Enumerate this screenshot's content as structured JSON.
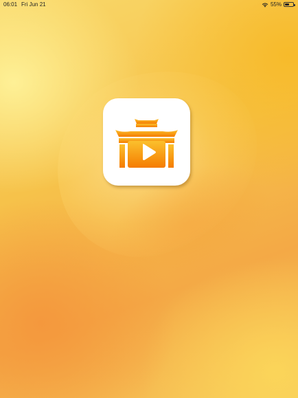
{
  "status_bar": {
    "time": "06:01",
    "date": "Fri Jun 21",
    "battery_percent_label": "55%",
    "battery_level": 0.55,
    "icons": [
      "wifi-icon",
      "battery-icon"
    ]
  },
  "app": {
    "icon": "temple-play-icon",
    "colors": {
      "background": "#ffffff",
      "gradient_top": "#fbc02d",
      "gradient_bottom": "#f57c00",
      "play_triangle": "#ffffff"
    }
  },
  "background_colors": [
    "#f9d86a",
    "#f6c24a",
    "#f4a946"
  ]
}
